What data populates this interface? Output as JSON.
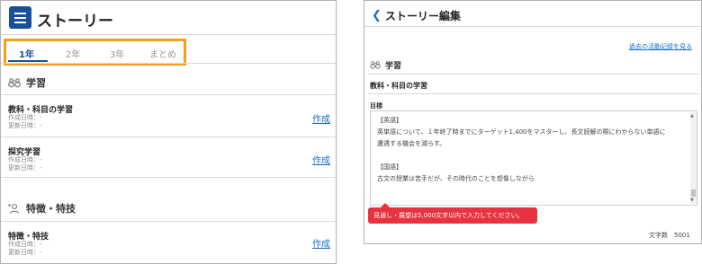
{
  "left_panel": {
    "title": "ストーリー",
    "tabs": [
      {
        "label": "1年",
        "active": true
      },
      {
        "label": "2年",
        "active": false
      },
      {
        "label": "3年",
        "active": false
      },
      {
        "label": "まとめ",
        "active": false
      }
    ],
    "sections": [
      {
        "name": "学習",
        "icon": "binoculars-icon",
        "items": [
          {
            "title": "教科・科目の学習",
            "created": "作成日時：-",
            "updated": "更新日時：-",
            "action": "作成"
          },
          {
            "title": "探究学習",
            "created": "作成日時：-",
            "updated": "更新日時：-",
            "action": "作成"
          }
        ]
      },
      {
        "name": "特徴・特技",
        "icon": "person-sparkle-icon",
        "items": [
          {
            "title": "特徴・特技",
            "created": "作成日時：-",
            "updated": "更新日時：-",
            "action": "作成"
          }
        ]
      }
    ]
  },
  "right_panel": {
    "title": "ストーリー編集",
    "history_link": "過去の活動記録を見る",
    "section": "学習",
    "subsection": "教科・科目の学習",
    "field_label": "目標",
    "textarea_lines": [
      "【英語】",
      "英単語について、１年終了時までにターゲット1,400をマスターし、長文読解の際にわからない単語に",
      "遭遇する機会を減らす。",
      "",
      "【国語】",
      "古文の授業は苦手だが、その時代のことを想像しながら"
    ],
    "error_message": "見通し・展望は5,000文字以内で入力してください。",
    "char_count": "文字数　5001"
  },
  "colors": {
    "brand": "#1a4f9c",
    "highlight": "#f5a01a",
    "link": "#1a6fc4",
    "error": "#e8323f"
  }
}
